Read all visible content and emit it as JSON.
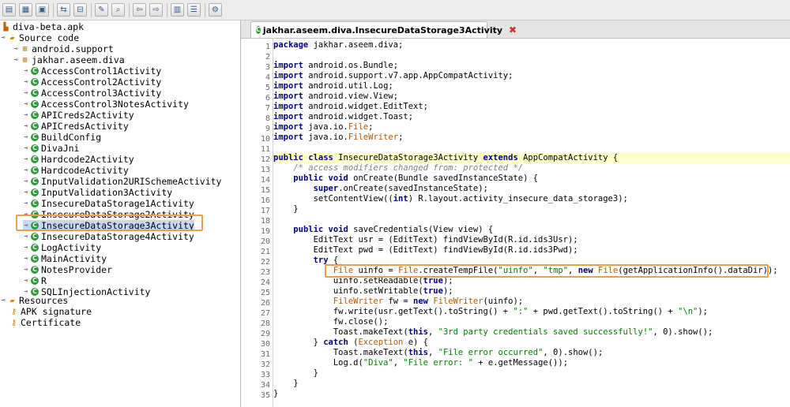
{
  "toolbar": {
    "buttons": [
      "open-file-icon",
      "save-all-icon",
      "export-icon",
      "sync-icon",
      "collapse-icon",
      "search-icon",
      "zoom-icon",
      "back-icon",
      "forward-icon",
      "save-icon",
      "log-icon",
      "preferences-icon"
    ]
  },
  "tree": {
    "root": "diva-beta.apk",
    "source_code": "Source code",
    "packages": [
      "android.support",
      "jakhar.aseem.diva"
    ],
    "classes": [
      "AccessControl1Activity",
      "AccessControl2Activity",
      "AccessControl3Activity",
      "AccessControl3NotesActivity",
      "APICreds2Activity",
      "APICredsActivity",
      "BuildConfig",
      "DivaJni",
      "Hardcode2Activity",
      "HardcodeActivity",
      "InputValidation2URISchemeActivity",
      "InputValidation3Activity",
      "InsecureDataStorage1Activity",
      "InsecureDataStorage2Activity",
      "InsecureDataStorage3Activity",
      "InsecureDataStorage4Activity",
      "LogActivity",
      "MainActivity",
      "NotesProvider",
      "R",
      "SQLInjectionActivity"
    ],
    "selected_class": "InsecureDataStorage3Activity",
    "resources": "Resources",
    "apk_signature": "APK signature",
    "certificate": "Certificate"
  },
  "editor": {
    "tab_title": "jakhar.aseem.diva.InsecureDataStorage3Activity",
    "tab_class_icon": "class-icon",
    "tab_close_icon": "close-icon",
    "line_numbers": [
      "1",
      "2",
      "3",
      "4",
      "5",
      "6",
      "7",
      "8",
      "9",
      "10",
      "11",
      "12",
      "13",
      "14",
      "15",
      "16",
      "17",
      "18",
      "19",
      "20",
      "21",
      "22",
      "23",
      "24",
      "25",
      "26",
      "27",
      "28",
      "29",
      "30",
      "31",
      "32",
      "33",
      "34",
      "35"
    ],
    "current_line": 12,
    "highlighted_line": 23,
    "code": [
      [
        {
          "t": "package",
          "c": "kw"
        },
        {
          "t": " jakhar.aseem.diva;"
        }
      ],
      [],
      [
        {
          "t": "import",
          "c": "kw"
        },
        {
          "t": " android.os.Bundle;"
        }
      ],
      [
        {
          "t": "import",
          "c": "kw"
        },
        {
          "t": " android.support.v7.app.AppCompatActivity;"
        }
      ],
      [
        {
          "t": "import",
          "c": "kw"
        },
        {
          "t": " android.util.Log;"
        }
      ],
      [
        {
          "t": "import",
          "c": "kw"
        },
        {
          "t": " android.view.View;"
        }
      ],
      [
        {
          "t": "import",
          "c": "kw"
        },
        {
          "t": " android.widget.EditText;"
        }
      ],
      [
        {
          "t": "import",
          "c": "kw"
        },
        {
          "t": " android.widget.Toast;"
        }
      ],
      [
        {
          "t": "import",
          "c": "kw"
        },
        {
          "t": " java.io."
        },
        {
          "t": "File",
          "c": "ty"
        },
        {
          "t": ";"
        }
      ],
      [
        {
          "t": "import",
          "c": "kw"
        },
        {
          "t": " java.io."
        },
        {
          "t": "FileWriter",
          "c": "ty"
        },
        {
          "t": ";"
        }
      ],
      [],
      [
        {
          "t": "public class",
          "c": "kw"
        },
        {
          "t": " InsecureDataStorage3Activity "
        },
        {
          "t": "extends",
          "c": "kw"
        },
        {
          "t": " AppCompatActivity {"
        }
      ],
      [
        {
          "t": "    "
        },
        {
          "t": "/* access modifiers changed from: protected */",
          "c": "cmt"
        }
      ],
      [
        {
          "t": "    "
        },
        {
          "t": "public void",
          "c": "kw"
        },
        {
          "t": " onCreate(Bundle savedInstanceState) {"
        }
      ],
      [
        {
          "t": "        "
        },
        {
          "t": "super",
          "c": "kw"
        },
        {
          "t": ".onCreate(savedInstanceState);"
        }
      ],
      [
        {
          "t": "        setContentView(("
        },
        {
          "t": "int",
          "c": "kw"
        },
        {
          "t": ") R.layout.activity_insecure_data_storage3);"
        }
      ],
      [
        {
          "t": "    }"
        }
      ],
      [],
      [
        {
          "t": "    "
        },
        {
          "t": "public void",
          "c": "kw"
        },
        {
          "t": " saveCredentials(View view) {"
        }
      ],
      [
        {
          "t": "        EditText usr = (EditText) findViewById(R.id.ids3Usr);"
        }
      ],
      [
        {
          "t": "        EditText pwd = (EditText) findViewById(R.id.ids3Pwd);"
        }
      ],
      [
        {
          "t": "        "
        },
        {
          "t": "try",
          "c": "kw"
        },
        {
          "t": " {"
        }
      ],
      [
        {
          "t": "            "
        },
        {
          "t": "File",
          "c": "ty"
        },
        {
          "t": " uinfo = "
        },
        {
          "t": "File",
          "c": "ty"
        },
        {
          "t": ".createTempFile("
        },
        {
          "t": "\"uinfo\"",
          "c": "str"
        },
        {
          "t": ", "
        },
        {
          "t": "\"tmp\"",
          "c": "str"
        },
        {
          "t": ", "
        },
        {
          "t": "new",
          "c": "kw"
        },
        {
          "t": " "
        },
        {
          "t": "File",
          "c": "ty"
        },
        {
          "t": "(getApplicationInfo().dataDir));"
        }
      ],
      [
        {
          "t": "            uinfo.setReadable("
        },
        {
          "t": "true",
          "c": "kw"
        },
        {
          "t": ");"
        }
      ],
      [
        {
          "t": "            uinfo.setWritable("
        },
        {
          "t": "true",
          "c": "kw"
        },
        {
          "t": ");"
        }
      ],
      [
        {
          "t": "            "
        },
        {
          "t": "FileWriter",
          "c": "ty"
        },
        {
          "t": " fw = "
        },
        {
          "t": "new",
          "c": "kw"
        },
        {
          "t": " "
        },
        {
          "t": "FileWriter",
          "c": "ty"
        },
        {
          "t": "(uinfo);"
        }
      ],
      [
        {
          "t": "            fw.write(usr.getText().toString() + "
        },
        {
          "t": "\":\"",
          "c": "str"
        },
        {
          "t": " + pwd.getText().toString() + "
        },
        {
          "t": "\"\\n\"",
          "c": "str"
        },
        {
          "t": ");"
        }
      ],
      [
        {
          "t": "            fw.close();"
        }
      ],
      [
        {
          "t": "            Toast.makeText("
        },
        {
          "t": "this",
          "c": "kw"
        },
        {
          "t": ", "
        },
        {
          "t": "\"3rd party credentials saved successfully!\"",
          "c": "str"
        },
        {
          "t": ", 0).show();"
        }
      ],
      [
        {
          "t": "        } "
        },
        {
          "t": "catch",
          "c": "kw"
        },
        {
          "t": " ("
        },
        {
          "t": "Exception",
          "c": "ty"
        },
        {
          "t": " e) {"
        }
      ],
      [
        {
          "t": "            Toast.makeText("
        },
        {
          "t": "this",
          "c": "kw"
        },
        {
          "t": ", "
        },
        {
          "t": "\"File error occurred\"",
          "c": "str"
        },
        {
          "t": ", 0).show();"
        }
      ],
      [
        {
          "t": "            Log.d("
        },
        {
          "t": "\"Diva\"",
          "c": "str"
        },
        {
          "t": ", "
        },
        {
          "t": "\"File error: \"",
          "c": "str"
        },
        {
          "t": " + e.getMessage());"
        }
      ],
      [
        {
          "t": "        }"
        }
      ],
      [
        {
          "t": "    }"
        }
      ],
      [
        {
          "t": "}"
        }
      ]
    ]
  }
}
